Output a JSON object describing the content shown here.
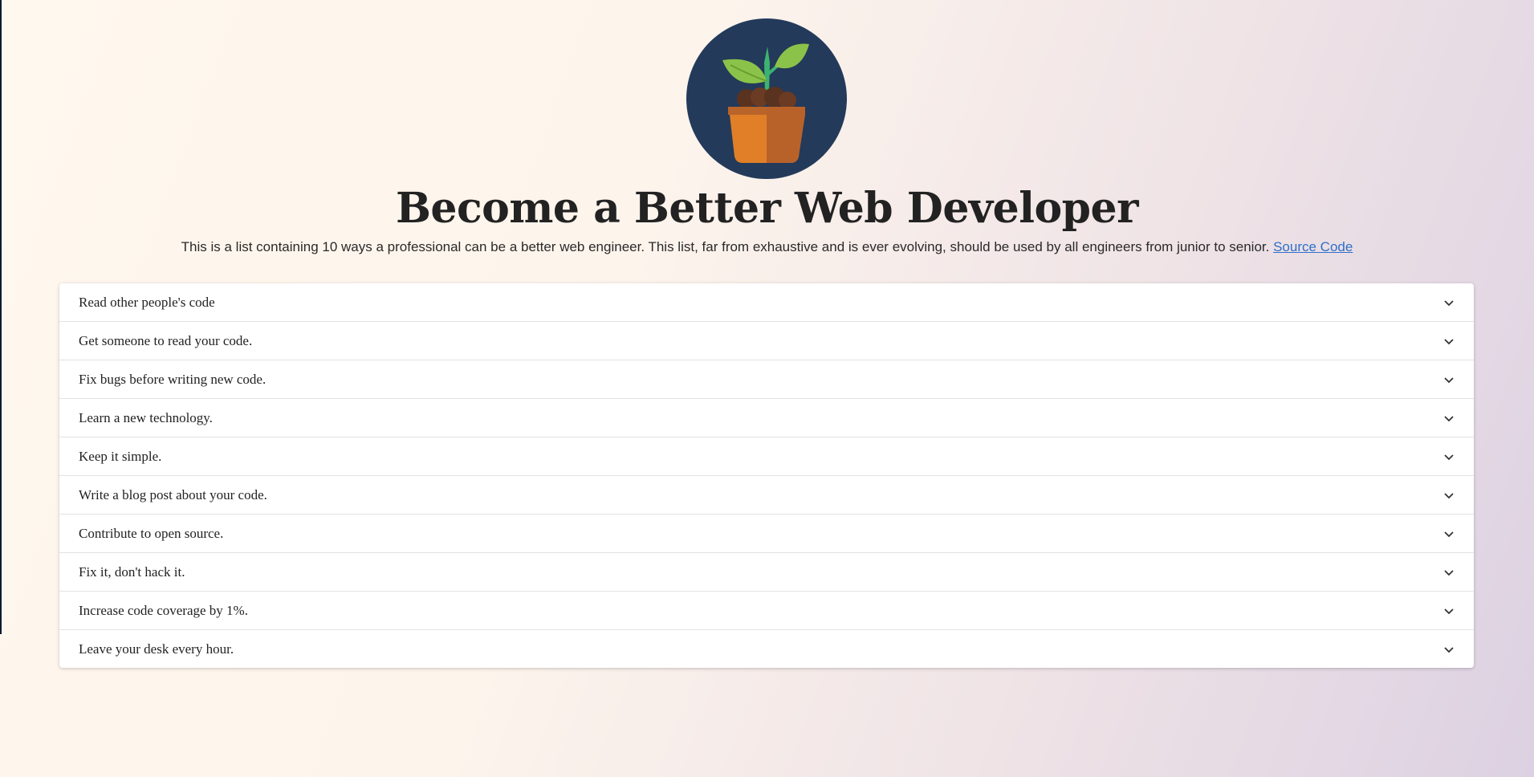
{
  "header": {
    "title": "Become a Better Web Developer",
    "subtitle": "This is a list containing 10 ways a professional can be a better web engineer. This list, far from exhaustive and is ever evolving, should be used by all engineers from junior to senior.",
    "source_link": "Source Code"
  },
  "logo": {
    "icon": "plant-pot-icon",
    "background_color": "#233a5a"
  },
  "accordion": {
    "items": [
      {
        "label": "Read other people's code"
      },
      {
        "label": "Get someone to read your code."
      },
      {
        "label": "Fix bugs before writing new code."
      },
      {
        "label": "Learn a new technology."
      },
      {
        "label": "Keep it simple."
      },
      {
        "label": "Write a blog post about your code."
      },
      {
        "label": "Contribute to open source."
      },
      {
        "label": "Fix it, don't hack it."
      },
      {
        "label": "Increase code coverage by 1%."
      },
      {
        "label": "Leave your desk every hour."
      }
    ]
  }
}
